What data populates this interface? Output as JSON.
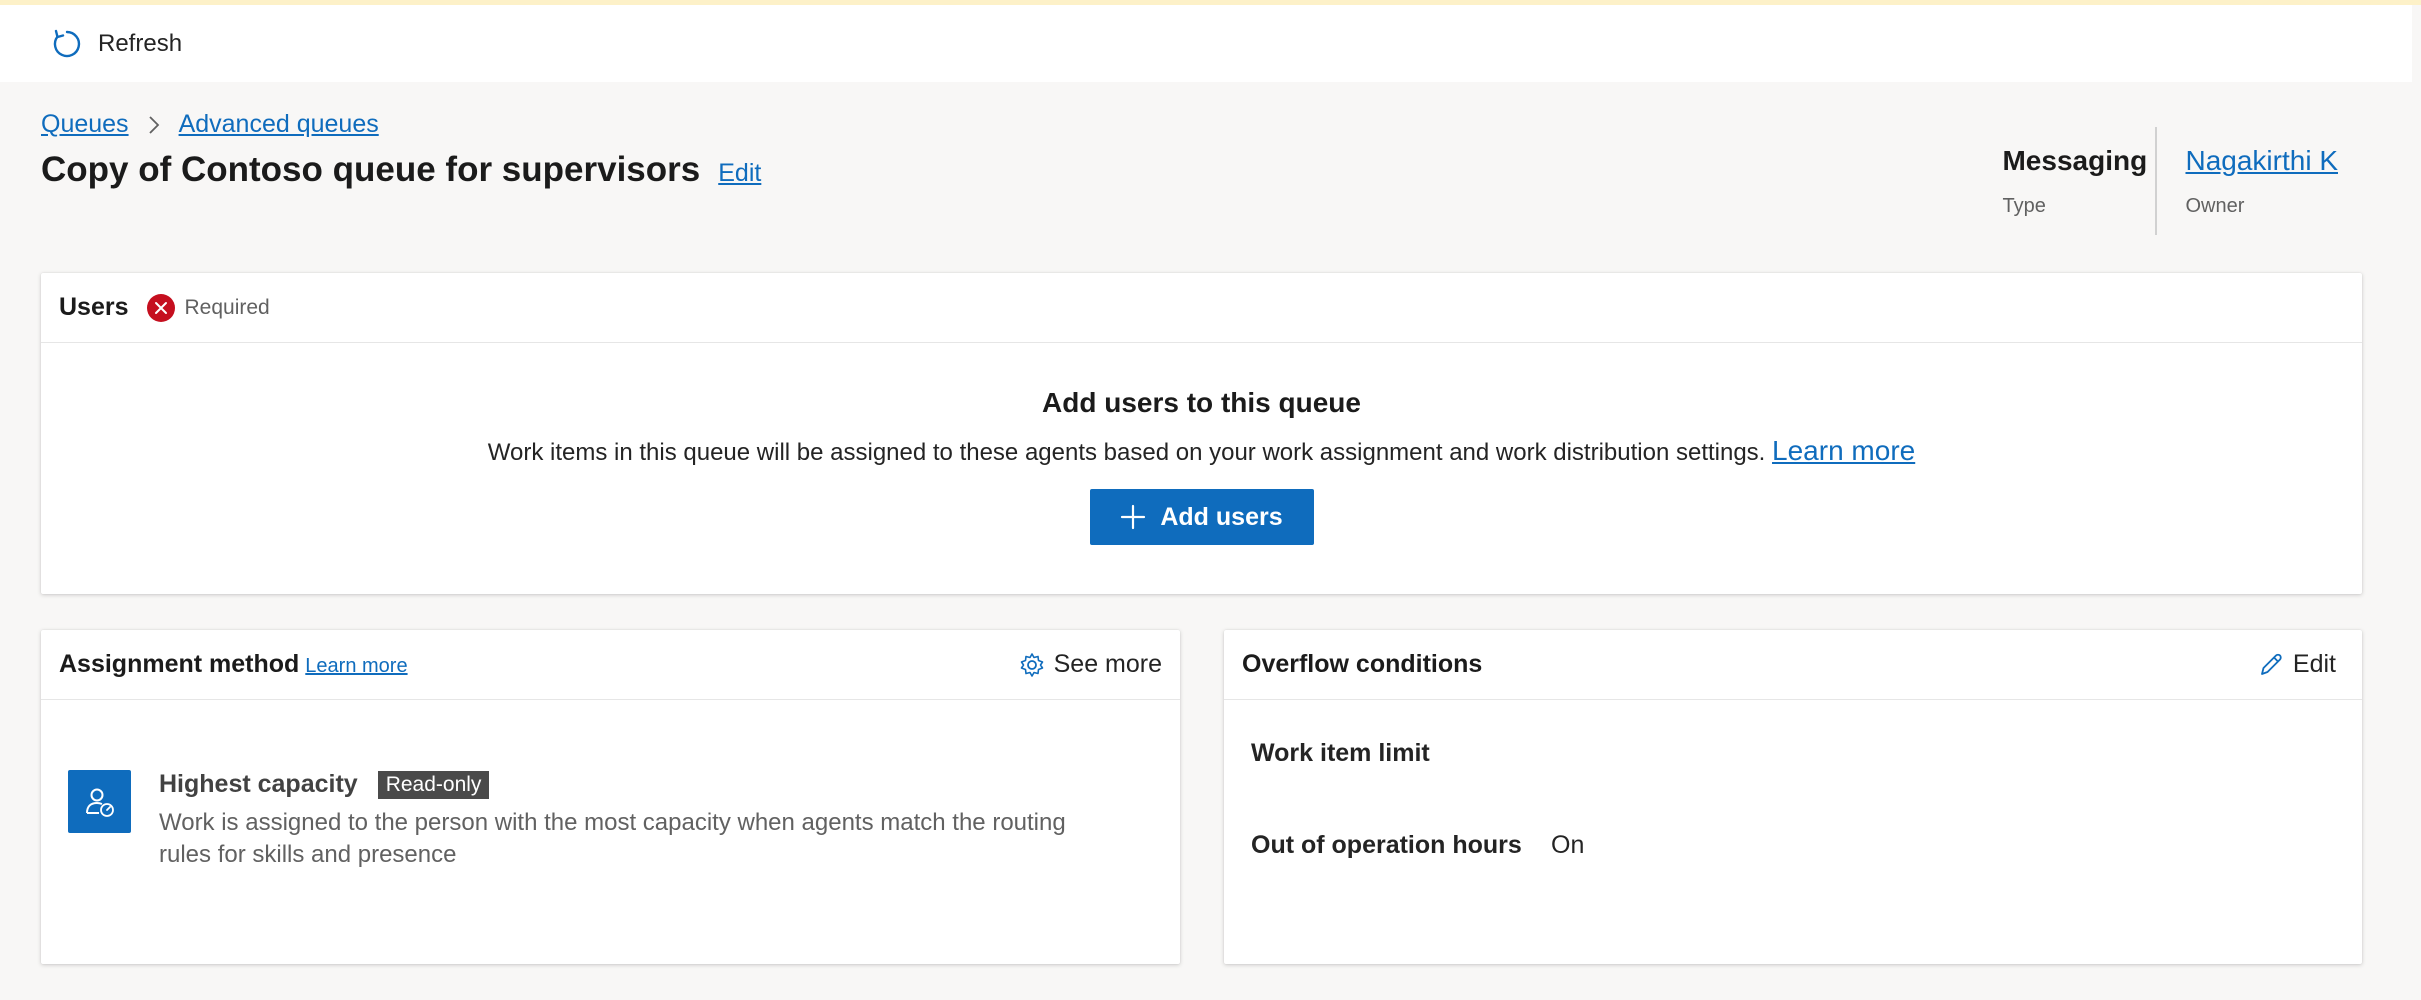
{
  "toolbar": {
    "refresh_label": "Refresh",
    "refresh_icon": "refresh-icon"
  },
  "breadcrumb": {
    "items": [
      "Queues",
      "Advanced queues"
    ]
  },
  "page": {
    "title": "Copy of Contoso queue for supervisors",
    "edit_label": "Edit"
  },
  "meta": {
    "type_value": "Messaging",
    "type_label": "Type",
    "owner_value": "Nagakirthi K",
    "owner_label": "Owner"
  },
  "users_card": {
    "title": "Users",
    "required_label": "Required",
    "heading": "Add users to this queue",
    "description": "Work items in this queue will be assigned to these agents based on your work assignment and work distribution settings.",
    "learn_more": "Learn more",
    "add_button": "Add users"
  },
  "assignment_card": {
    "title": "Assignment method",
    "learn_more": "Learn more",
    "see_more": "See more",
    "method_name": "Highest capacity",
    "badge": "Read-only",
    "method_description": "Work is assigned to the person with the most capacity when agents match the routing rules for skills and presence"
  },
  "overflow_card": {
    "title": "Overflow conditions",
    "edit_label": "Edit",
    "rows": [
      {
        "key": "Work item limit",
        "value": ""
      },
      {
        "key": "Out of operation hours",
        "value": "On"
      }
    ]
  },
  "colors": {
    "accent": "#0f6cbd",
    "error": "#c50f1f",
    "badge_bg": "#4a4a4a"
  }
}
